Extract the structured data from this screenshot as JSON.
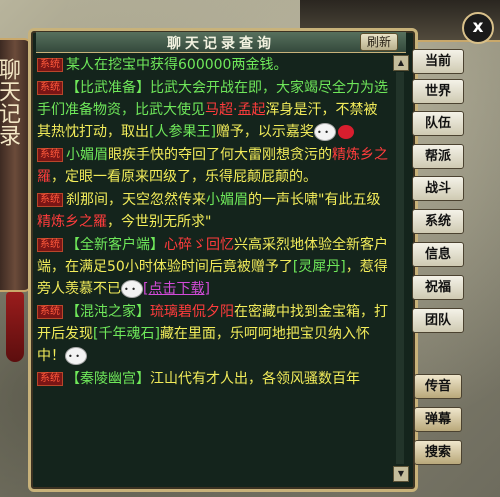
{
  "window": {
    "title": "聊天记录查询",
    "refresh_label": "刷新",
    "close_label": "x",
    "left_scroll_title": "聊天记录"
  },
  "tabs": [
    {
      "label": "当前"
    },
    {
      "label": "世界"
    },
    {
      "label": "队伍"
    },
    {
      "label": "帮派"
    },
    {
      "label": "战斗"
    },
    {
      "label": "系统"
    },
    {
      "label": "信息"
    },
    {
      "label": "祝福"
    },
    {
      "label": "团队"
    },
    {
      "label": "传音"
    },
    {
      "label": "弹幕"
    },
    {
      "label": "搜索"
    }
  ],
  "messages": [
    {
      "tag": "系统",
      "parts": [
        {
          "t": "某人在挖宝中获得600000两金钱。",
          "c": "g"
        }
      ]
    },
    {
      "tag": "系统",
      "parts": [
        {
          "t": "【比武准备】比武大会开战在即，大家竭尽全力为选手们准备物资，比武大使见",
          "c": "g"
        },
        {
          "t": "马超·孟起",
          "c": "r"
        },
        {
          "t": "浑身是汗，不禁被其热忱打动，取出",
          "c": "y"
        },
        {
          "t": "[人参果王]",
          "c": "g"
        },
        {
          "t": "赠予，以示嘉奖",
          "c": "y"
        }
      ]
    },
    {
      "tag": "系统",
      "parts": [
        {
          "t": "小媚眉",
          "c": "g"
        },
        {
          "t": "眼疾手快的夺回了何大雷刚想贪污的",
          "c": "y"
        },
        {
          "t": "精炼乡之羅",
          "c": "r"
        },
        {
          "t": "，定眼一看原来四级了，乐得屁颠屁颠的。",
          "c": "y"
        }
      ]
    },
    {
      "tag": "系统",
      "parts": [
        {
          "t": "刹那间，天空忽然传来",
          "c": "y"
        },
        {
          "t": "小媚眉",
          "c": "g"
        },
        {
          "t": "的一声长啸\"有此五级",
          "c": "y"
        },
        {
          "t": "精炼乡之羅",
          "c": "r"
        },
        {
          "t": "，今世别无所求\"",
          "c": "y"
        }
      ]
    },
    {
      "tag": "系统",
      "parts": [
        {
          "t": "【全新客户端】",
          "c": "g"
        },
        {
          "t": "心碎ゞ回忆",
          "c": "r"
        },
        {
          "t": "兴高采烈地体验全新客户端，在满足50小时体验时间后竟被赠予了",
          "c": "y"
        },
        {
          "t": "[灵犀丹]",
          "c": "g"
        },
        {
          "t": "，惹得旁人羡慕不已",
          "c": "y"
        },
        {
          "t": "[点击下载]",
          "c": "m",
          "u": true
        }
      ]
    },
    {
      "tag": "系统",
      "parts": [
        {
          "t": "【混沌之家】",
          "c": "g"
        },
        {
          "t": "琉璃碧侃夕阳",
          "c": "r"
        },
        {
          "t": "在密藏中找到金宝箱，打开后发现",
          "c": "y"
        },
        {
          "t": "[千年魂石]",
          "c": "g"
        },
        {
          "t": "藏在里面，乐呵呵地把宝贝纳入怀中！",
          "c": "y"
        }
      ]
    },
    {
      "tag": "系统",
      "parts": [
        {
          "t": "【秦陵幽宫】",
          "c": "g"
        },
        {
          "t": "江山代有才人出，各领风骚数百年",
          "c": "y"
        }
      ]
    }
  ]
}
